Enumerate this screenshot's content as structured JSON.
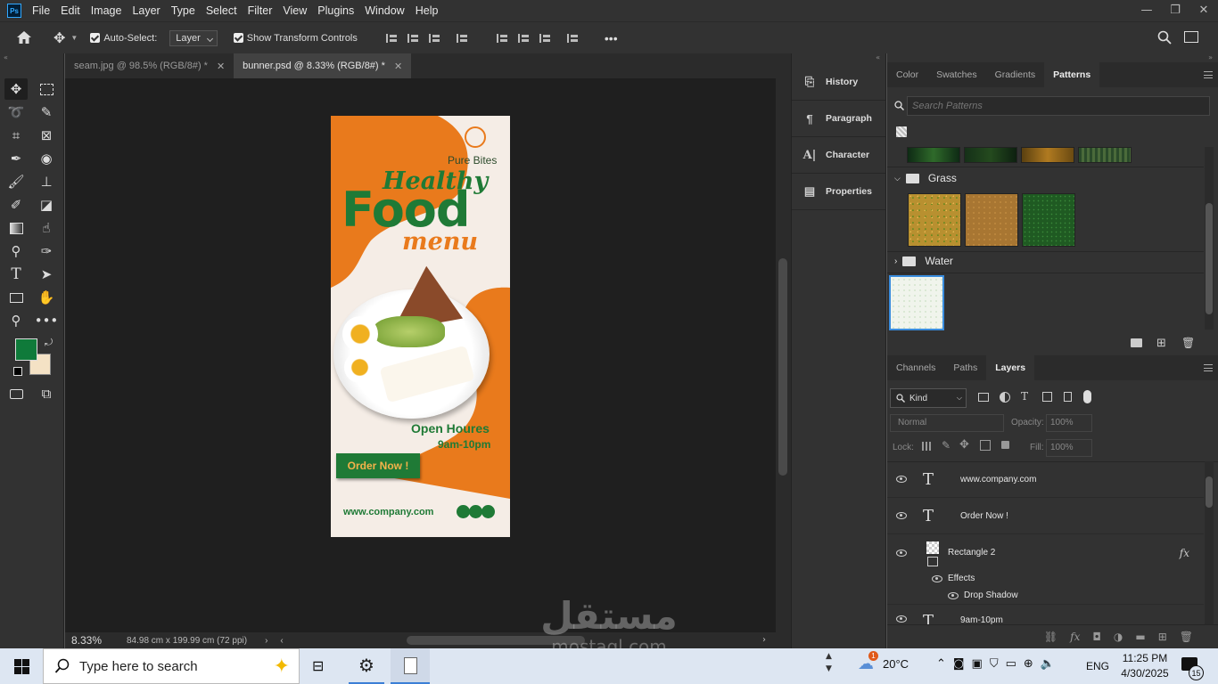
{
  "menubar": {
    "logo": "Ps",
    "items": [
      "File",
      "Edit",
      "Image",
      "Layer",
      "Type",
      "Select",
      "Filter",
      "View",
      "Plugins",
      "Window",
      "Help"
    ]
  },
  "options": {
    "auto_select_label": "Auto-Select:",
    "auto_select_value": "Layer",
    "show_transform_label": "Show Transform Controls",
    "more": "•••"
  },
  "tabs": [
    {
      "label": "seam.jpg @ 98.5% (RGB/8#) *",
      "active": false
    },
    {
      "label": "bunner.psd @ 8.33% (RGB/8#) *",
      "active": true
    }
  ],
  "status": {
    "zoom": "8.33%",
    "doc_size": "84.98 cm x 199.99 cm (72 ppi)"
  },
  "colors": {
    "foreground": "#0f7a3a",
    "background": "#f4e2c5",
    "accent_orange": "#e97a1c",
    "brand_green": "#1f7a36"
  },
  "poster": {
    "brand": "Pure Bites",
    "headline1": "Healthy",
    "headline2": "Food",
    "headline3": "menu",
    "open_title": "Open Houres",
    "open_time": "9am-10pm",
    "cta": "Order Now !",
    "website": "www.company.com"
  },
  "mid_panels": [
    {
      "label": "History",
      "icon": "history-icon"
    },
    {
      "label": "Paragraph",
      "icon": "paragraph-icon"
    },
    {
      "label": "Character",
      "icon": "character-icon"
    },
    {
      "label": "Properties",
      "icon": "properties-icon"
    }
  ],
  "top_panel": {
    "tabs": [
      "Color",
      "Swatches",
      "Gradients",
      "Patterns"
    ],
    "active": "Patterns",
    "search_placeholder": "Search Patterns",
    "folders": [
      {
        "name": "Grass",
        "expanded": true
      },
      {
        "name": "Water",
        "expanded": false
      }
    ]
  },
  "layers_panel": {
    "tabs": [
      "Channels",
      "Paths",
      "Layers"
    ],
    "active": "Layers",
    "filter": "Kind",
    "blend": "Normal",
    "opacity_label": "Opacity:",
    "opacity": "100%",
    "lock_label": "Lock:",
    "fill_label": "Fill:",
    "fill": "100%",
    "layers": [
      {
        "name": "www.company.com",
        "type": "text"
      },
      {
        "name": "Order Now !",
        "type": "text"
      },
      {
        "name": "Rectangle 2",
        "type": "shape",
        "fx": "fx"
      },
      {
        "name": "Effects",
        "type": "effects"
      },
      {
        "name": "Drop Shadow",
        "type": "effect"
      },
      {
        "name": "9am-10pm",
        "type": "text"
      }
    ]
  },
  "taskbar": {
    "search_placeholder": "Type here to search",
    "weather": "20°C",
    "weather_badge": "1",
    "lang": "ENG",
    "time": "11:25 PM",
    "date": "4/30/2025",
    "notif_count": "15"
  },
  "watermark": {
    "arabic": "مستقل",
    "latin": "mostaql.com"
  }
}
